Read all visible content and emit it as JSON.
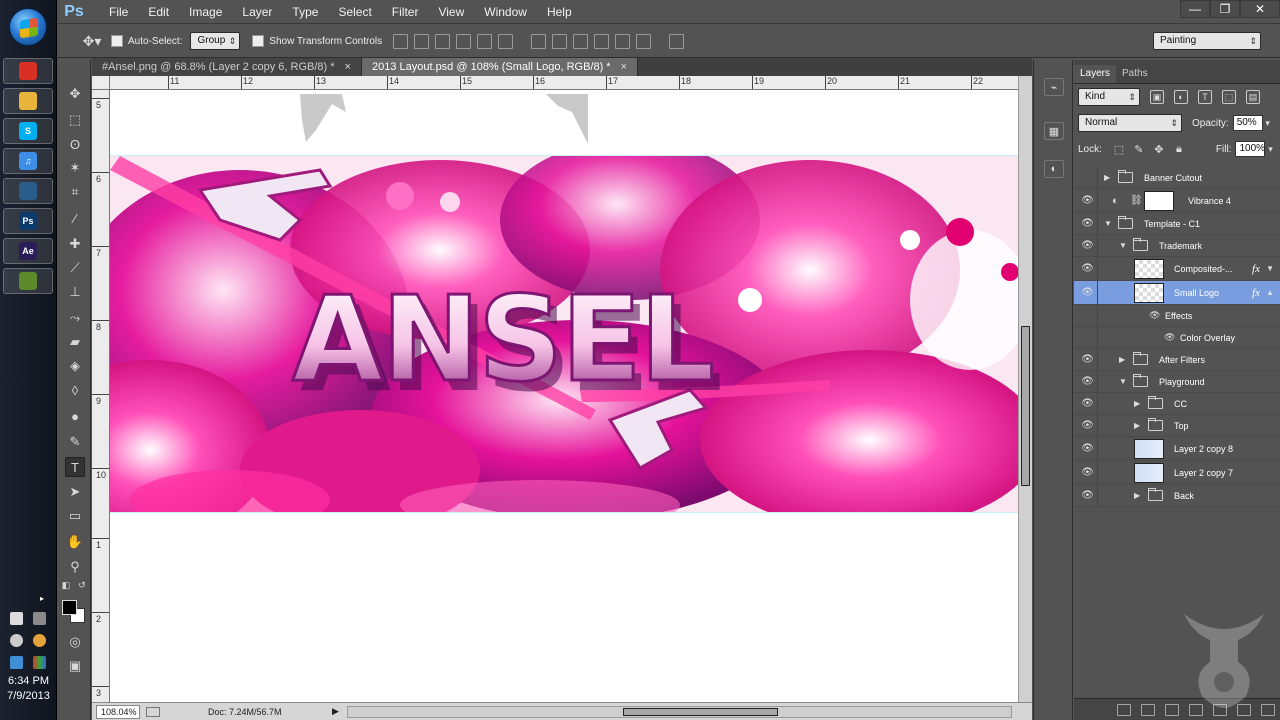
{
  "app": {
    "name": "Ps",
    "menu": [
      "File",
      "Edit",
      "Image",
      "Layer",
      "Type",
      "Select",
      "Filter",
      "View",
      "Window",
      "Help"
    ],
    "window_controls": [
      "—",
      "❐",
      "✕"
    ]
  },
  "options_bar": {
    "auto_select_label": "Auto-Select:",
    "auto_select_value": "Group",
    "show_transform_label": "Show Transform Controls",
    "workspace": "Painting"
  },
  "document": {
    "tabs": [
      {
        "label": "#Ansel.png @ 68.8% (Layer 2 copy 6, RGB/8) *",
        "active": false
      },
      {
        "label": "2013 Layout.psd @ 108% (Small Logo, RGB/8) *",
        "active": true
      }
    ],
    "ruler_h": [
      "11",
      "12",
      "13",
      "14",
      "15",
      "16",
      "17",
      "18",
      "19",
      "20",
      "21",
      "22"
    ],
    "ruler_v": [
      "5",
      "6",
      "7",
      "8",
      "9",
      "10",
      "1",
      "2",
      "3"
    ],
    "artwork_text": "ANSEL",
    "zoom": "108.04%",
    "doc_size": "Doc: 7.24M/56.7M"
  },
  "taskbar": {
    "clock_time": "6:34 PM",
    "clock_date": "7/9/2013",
    "apps": [
      {
        "icon": "chrome-icon",
        "color": "#d93025",
        "glyph": "",
        "active": true
      },
      {
        "icon": "explorer-icon",
        "color": "#e9b43a",
        "glyph": "",
        "active": true
      },
      {
        "icon": "skype-icon",
        "color": "#00aff0",
        "glyph": "S",
        "active": true
      },
      {
        "icon": "itunes-icon",
        "color": "#3e8ee8",
        "glyph": "♫",
        "active": true
      },
      {
        "icon": "steam-icon",
        "color": "#2a5d8a",
        "glyph": "",
        "active": true
      },
      {
        "icon": "photoshop-icon",
        "color": "#0b3a6b",
        "glyph": "Ps",
        "active": true
      },
      {
        "icon": "aftereffects-icon",
        "color": "#2b1d58",
        "glyph": "Ae",
        "active": true
      },
      {
        "icon": "gamepad-icon",
        "color": "#5c8a2a",
        "glyph": "",
        "active": true
      }
    ]
  },
  "layers_panel": {
    "tabs": [
      "Layers",
      "Paths"
    ],
    "kind": "Kind",
    "blend_mode": "Normal",
    "opacity_label": "Opacity:",
    "opacity": "50%",
    "lock_label": "Lock:",
    "fill_label": "Fill:",
    "fill": "100%",
    "layers": [
      {
        "name": "Banner Cutout",
        "type": "group",
        "indent": 0,
        "visible": false,
        "expanded": false
      },
      {
        "name": "Vibrance 4",
        "type": "adjustment",
        "indent": 0,
        "visible": true
      },
      {
        "name": "Template - C1",
        "type": "group",
        "indent": 0,
        "visible": true,
        "expanded": true
      },
      {
        "name": "Trademark",
        "type": "group",
        "indent": 1,
        "visible": true,
        "expanded": true
      },
      {
        "name": "Composited-...",
        "type": "layer",
        "indent": 2,
        "visible": true,
        "fx": true
      },
      {
        "name": "Small Logo",
        "type": "layer",
        "indent": 2,
        "visible": true,
        "fx": true,
        "selected": true
      },
      {
        "name": "Effects",
        "type": "effects",
        "indent": 3,
        "visible": true
      },
      {
        "name": "Color Overlay",
        "type": "effect",
        "indent": 4,
        "visible": true
      },
      {
        "name": "After Filters",
        "type": "group",
        "indent": 1,
        "visible": true,
        "expanded": false
      },
      {
        "name": "Playground",
        "type": "group",
        "indent": 1,
        "visible": true,
        "expanded": true
      },
      {
        "name": "CC",
        "type": "group",
        "indent": 2,
        "visible": true,
        "expanded": false
      },
      {
        "name": "Top",
        "type": "group",
        "indent": 2,
        "visible": true,
        "expanded": false
      },
      {
        "name": "Layer 2 copy 8",
        "type": "layer",
        "indent": 2,
        "visible": true,
        "art": true
      },
      {
        "name": "Layer 2 copy 7",
        "type": "layer",
        "indent": 2,
        "visible": true,
        "art": true
      },
      {
        "name": "Back",
        "type": "group",
        "indent": 2,
        "visible": true,
        "expanded": false
      }
    ]
  }
}
